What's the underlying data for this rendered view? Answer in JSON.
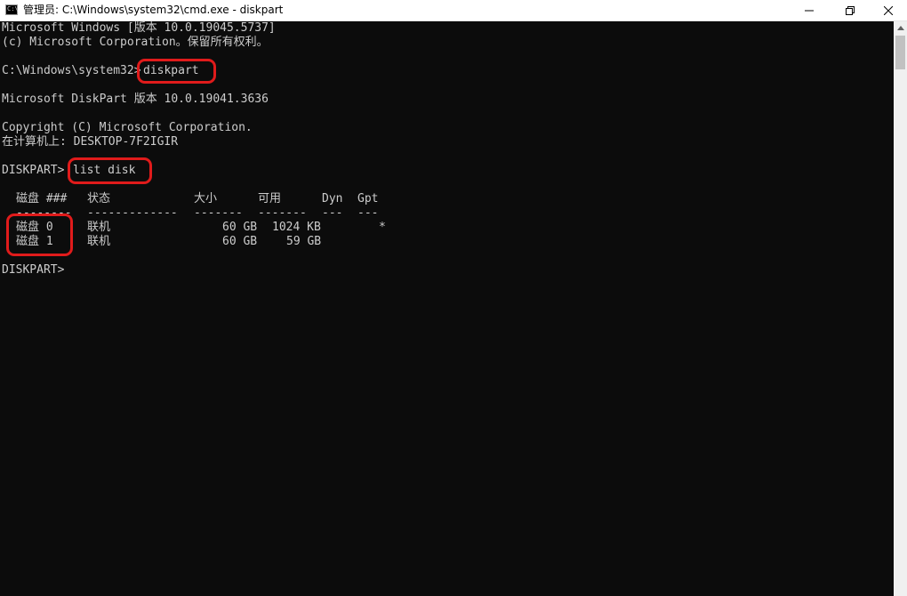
{
  "window": {
    "title": "管理员: C:\\Windows\\system32\\cmd.exe - diskpart",
    "icon_text": "C:\\"
  },
  "console": {
    "line_1": "Microsoft Windows [版本 10.0.19045.5737]",
    "line_2": "(c) Microsoft Corporation。保留所有权利。",
    "prompt_1": "C:\\Windows\\system32>",
    "command_1": "diskpart",
    "diskpart_version": "Microsoft DiskPart 版本 10.0.19041.3636",
    "copyright": "Copyright (C) Microsoft Corporation.",
    "computer": "在计算机上: DESKTOP-7F2IGIR",
    "prompt_2": "DISKPART>",
    "command_2": "list disk",
    "prompt_3": "DISKPART>"
  },
  "disk_table": {
    "headers": [
      "磁盘 ###",
      "状态",
      "大小",
      "可用",
      "Dyn",
      "Gpt"
    ],
    "separators": [
      "--------",
      "-------------",
      "-------",
      "-------",
      "---",
      "---"
    ],
    "rows": [
      {
        "disk": "磁盘 0",
        "status": "联机",
        "size": "60 GB",
        "free": "1024 KB",
        "dyn": "",
        "gpt": "*"
      },
      {
        "disk": "磁盘 1",
        "status": "联机",
        "size": "60 GB",
        "free": "59 GB",
        "dyn": "",
        "gpt": ""
      }
    ]
  },
  "colors": {
    "console_bg": "#0c0c0c",
    "console_text": "#cccccc",
    "highlight": "#e01b1b"
  },
  "icons": [
    "cmd-app-icon",
    "minimize-icon",
    "maximize-icon",
    "close-icon",
    "scroll-up-icon"
  ]
}
